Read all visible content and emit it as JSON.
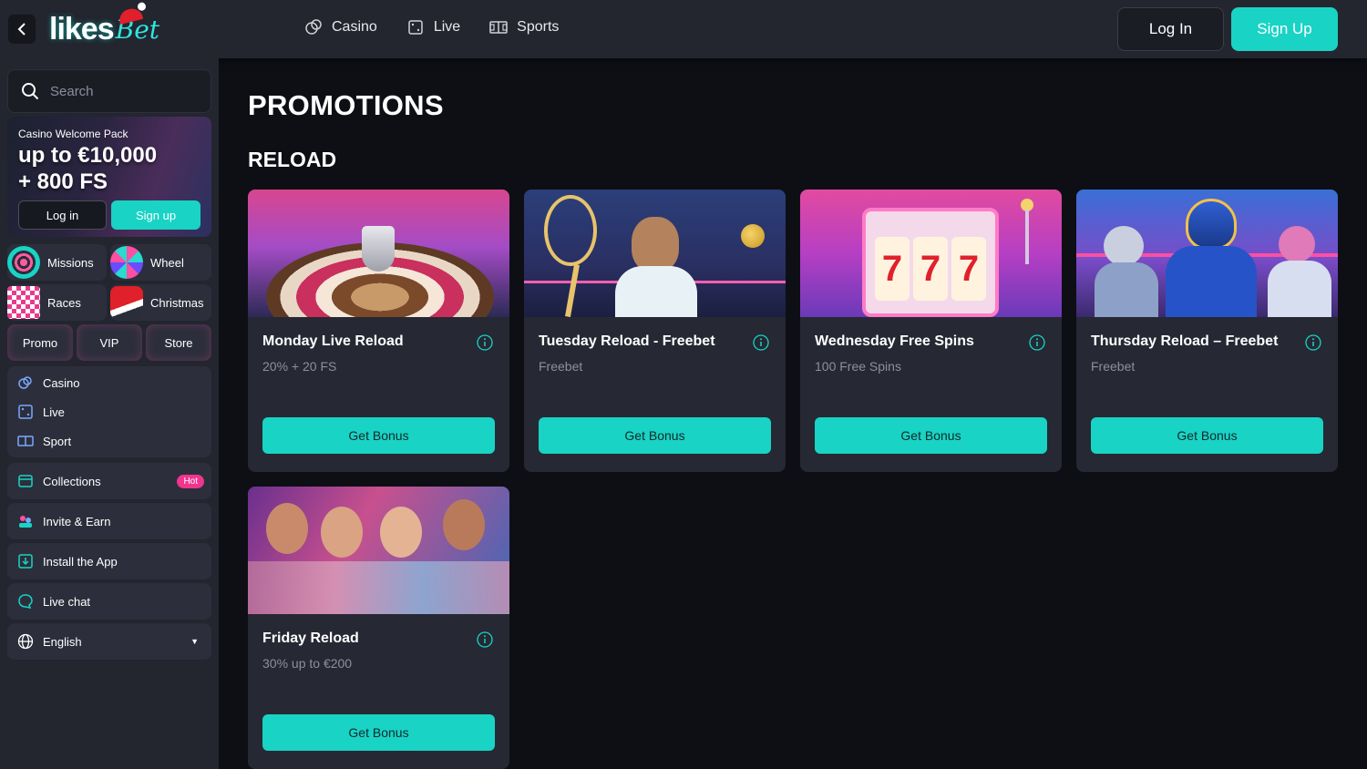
{
  "header": {
    "logo_main": "likes",
    "logo_script": "Bet",
    "nav": [
      {
        "label": "Casino",
        "icon": "casino-chips-icon"
      },
      {
        "label": "Live",
        "icon": "live-dice-icon"
      },
      {
        "label": "Sports",
        "icon": "sports-field-icon"
      }
    ],
    "login_label": "Log In",
    "signup_label": "Sign Up"
  },
  "sidebar": {
    "search_placeholder": "Search",
    "welcome": {
      "subtitle": "Casino Welcome Pack",
      "amount_line1": "up to €10,000",
      "amount_line2": "+ 800 FS",
      "login_label": "Log in",
      "signup_label": "Sign up"
    },
    "tiles": [
      {
        "label": "Missions",
        "icon": "missions-target-icon"
      },
      {
        "label": "Wheel",
        "icon": "wheel-icon"
      },
      {
        "label": "Races",
        "icon": "races-flag-icon"
      },
      {
        "label": "Christmas",
        "icon": "christmas-hat-icon"
      }
    ],
    "mini_tiles": [
      "Promo",
      "VIP",
      "Store"
    ],
    "games_menu": [
      {
        "label": "Casino",
        "icon": "casino-icon"
      },
      {
        "label": "Live",
        "icon": "live-icon"
      },
      {
        "label": "Sport",
        "icon": "sport-icon"
      }
    ],
    "collections": {
      "label": "Collections",
      "badge": "Hot"
    },
    "invite": "Invite & Earn",
    "install": "Install the App",
    "livechat": "Live chat",
    "language": "English"
  },
  "main": {
    "title": "PROMOTIONS",
    "section": "RELOAD",
    "button_label": "Get Bonus",
    "cards": [
      {
        "title": "Monday Live Reload",
        "subtitle": "20% + 20 FS",
        "image": "roulette-wheel"
      },
      {
        "title": "Tuesday Reload - Freebet",
        "subtitle": "Freebet",
        "image": "tennis-player"
      },
      {
        "title": "Wednesday Free Spins",
        "subtitle": "100 Free Spins",
        "image": "slot-machine"
      },
      {
        "title": "Thursday Reload – Freebet",
        "subtitle": "Freebet",
        "image": "american-football"
      },
      {
        "title": "Friday Reload",
        "subtitle": "30% up to €200",
        "image": "party-women"
      }
    ]
  },
  "colors": {
    "accent": "#19d3c5",
    "hot_badge": "#f1358f",
    "page_bg": "#0d0f15",
    "panel_bg": "#23252f",
    "card_bg": "#262833"
  }
}
